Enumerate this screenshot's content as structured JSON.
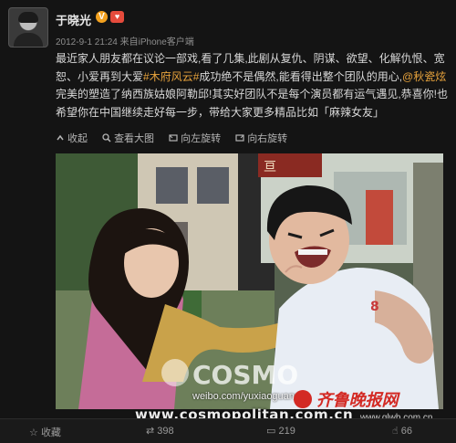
{
  "post": {
    "username": "于晓光",
    "verified_mark": "V",
    "heart_mark": "♥",
    "meta_time": "2012-9-1 21:24",
    "meta_source": "来自iPhone客户端",
    "text_parts": [
      "最近家人朋友都在议论一部戏,看了几集,此剧从复仇、阴谋、欲望、化解仇恨、宽恕、小爱再到大爱",
      "#木府风云#",
      "成功绝不是偶然,能看得出整个团队的用心,",
      "@秋瓷炫",
      " 完美的塑造了纳西族姑娘阿勒邱!其实好团队不是每个演员都有运气遇见,恭喜你!也希望你在中国继续走好每一步，带给大家更多精品比如「麻辣女友」"
    ],
    "actions": [
      "收起",
      "查看大图",
      "向左旋转",
      "向右旋转"
    ]
  },
  "photo": {
    "sign_text": "亘",
    "watermark_user": "weibo.com/yuxiaoguang",
    "watermark_brand": "COSMO",
    "watermark_site": "www.cosmopolitan.com.cn",
    "paper_brand": "齐鲁晚报网",
    "paper_site": "www.qlwb.com.cn"
  },
  "footer": {
    "fav_label": "收藏",
    "repost_count": "398",
    "comment_count": "219",
    "like_count": "66"
  }
}
